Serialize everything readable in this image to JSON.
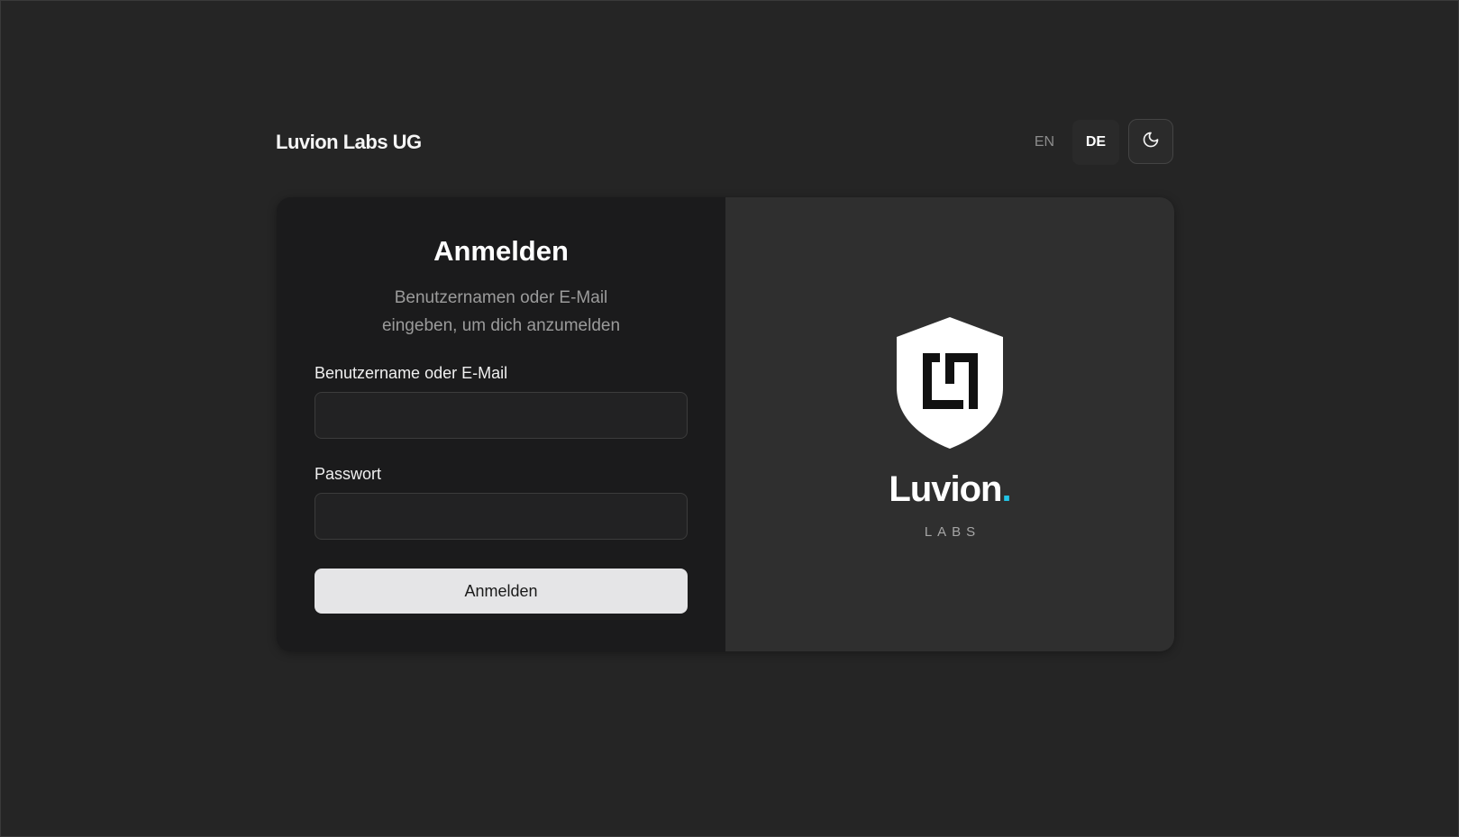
{
  "header": {
    "brand": "Luvion Labs UG",
    "languages": [
      "EN",
      "DE"
    ],
    "active_language": "DE",
    "theme_toggle_icon": "moon-icon"
  },
  "login": {
    "title": "Anmelden",
    "subtitle_line1": "Benutzernamen oder E-Mail",
    "subtitle_line2": "eingeben, um dich anzumelden",
    "username_label": "Benutzername oder E-Mail",
    "username_value": "",
    "password_label": "Passwort",
    "password_value": "",
    "submit_label": "Anmelden"
  },
  "branding": {
    "logo_icon": "shield-logo-icon",
    "name": "Luvion",
    "name_dot": ".",
    "sub": "LABS",
    "accent_color": "#22c4e6"
  }
}
